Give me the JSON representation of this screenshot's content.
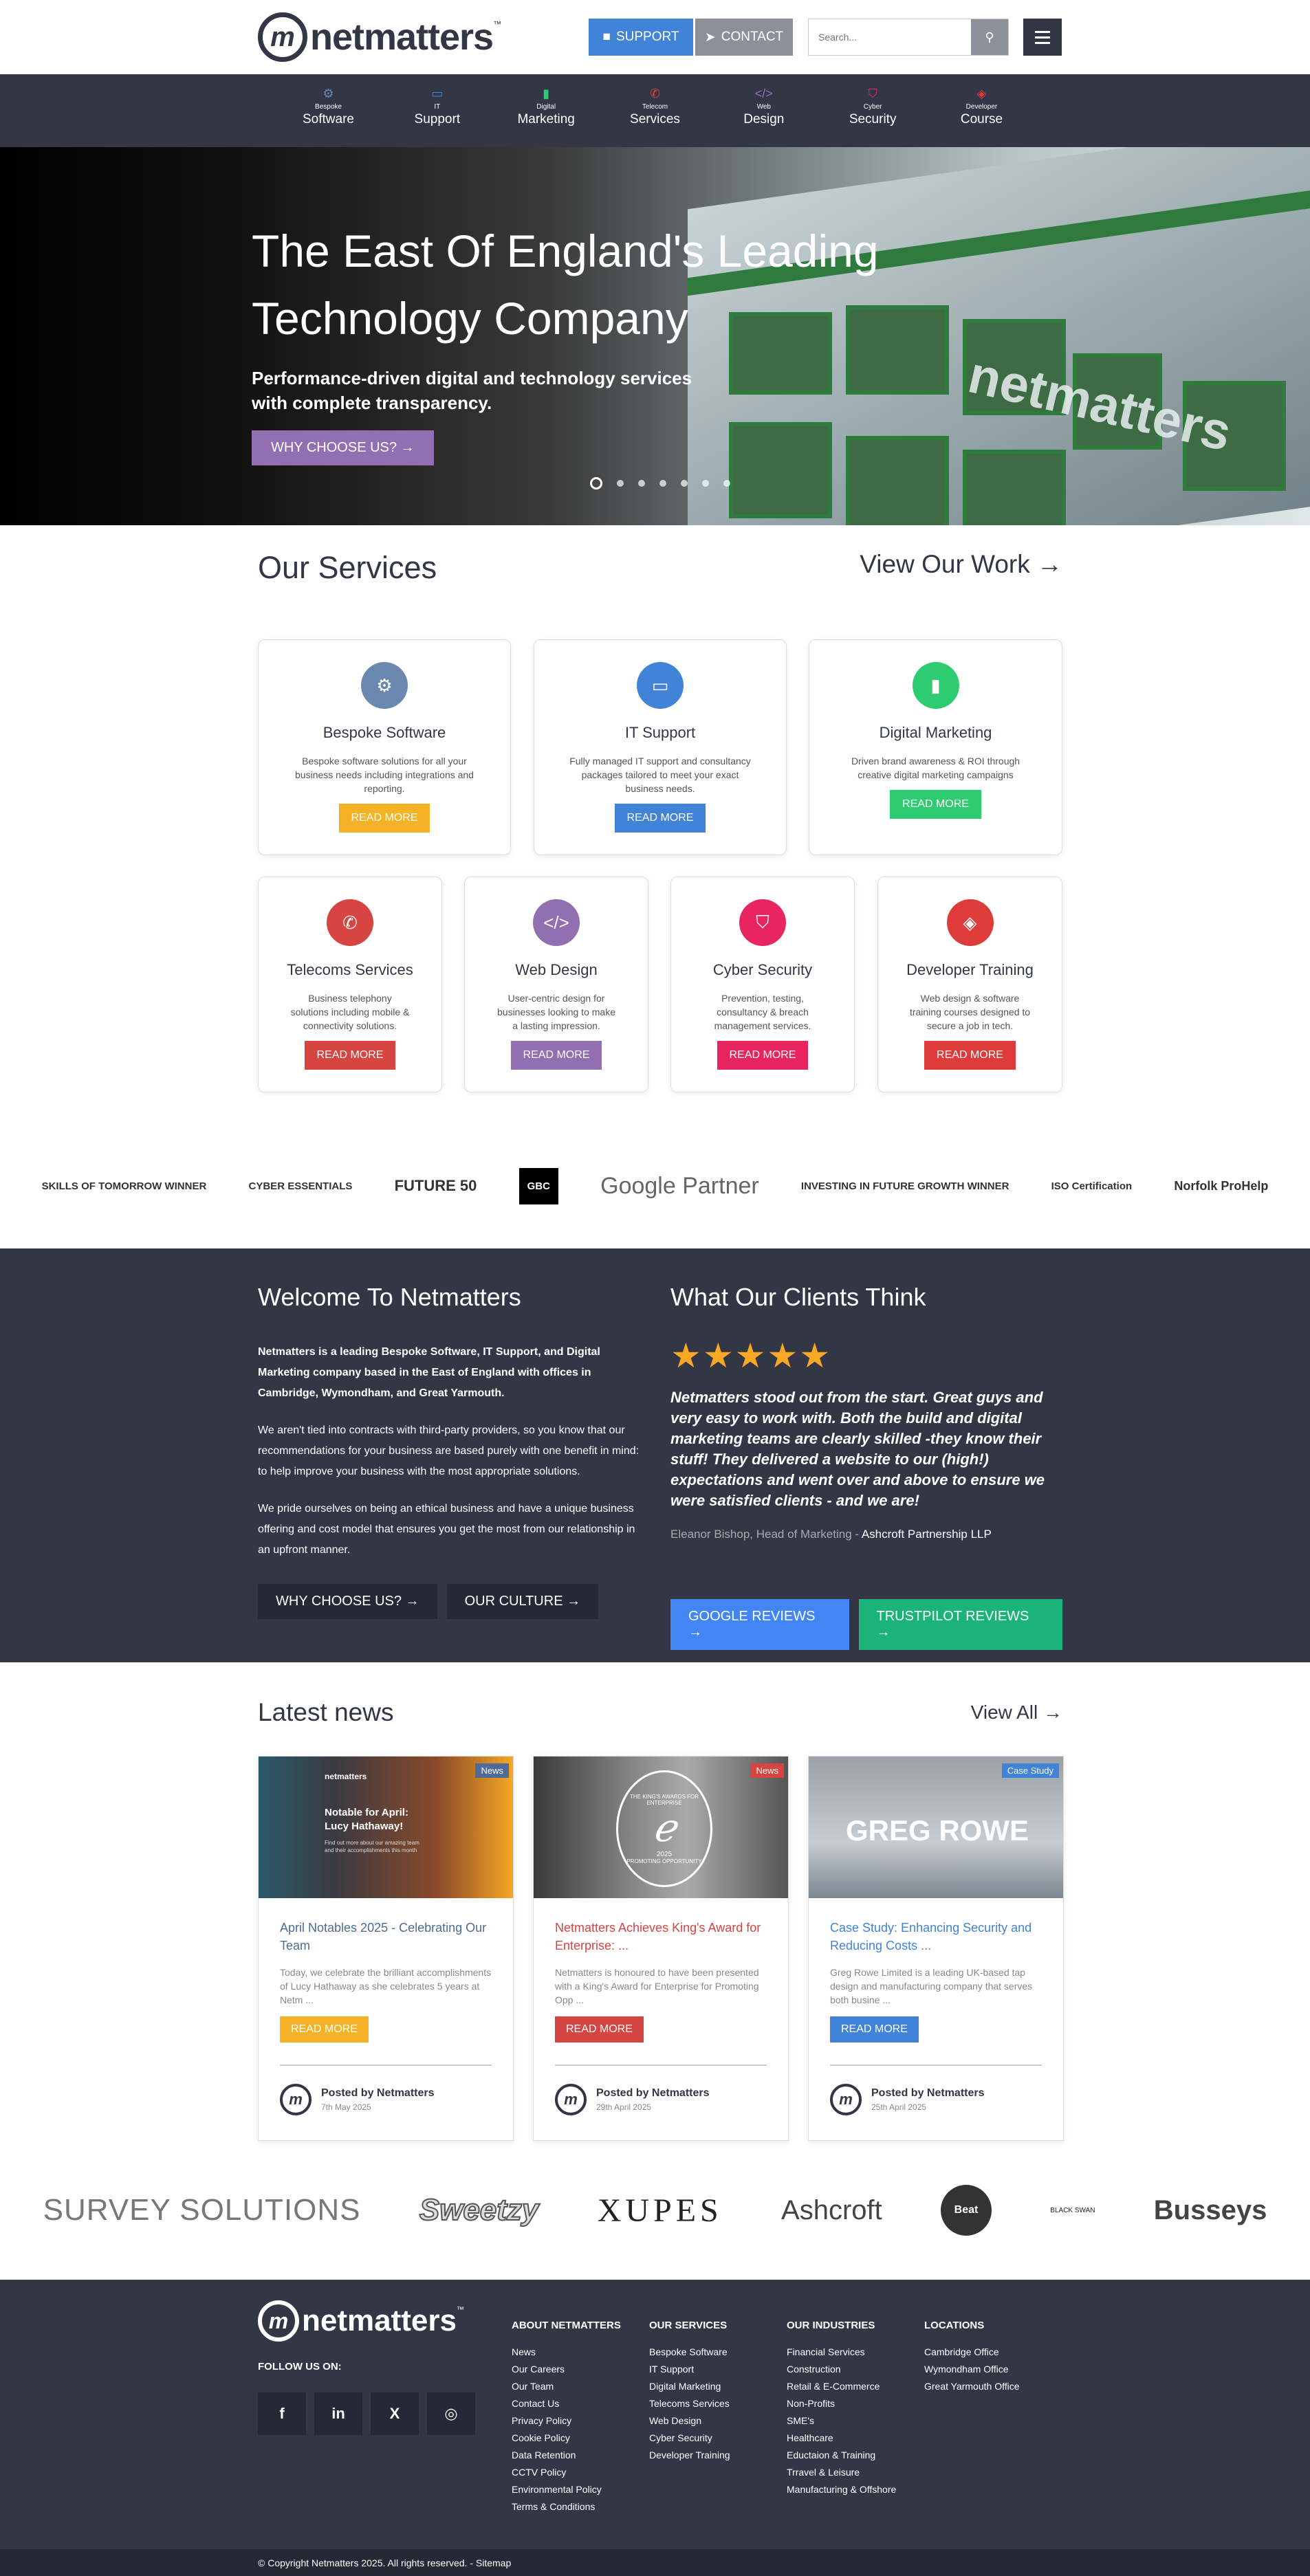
{
  "header": {
    "logo_text": "netmatters",
    "logo_mark": "m",
    "logo_tm": "™",
    "support_label": "SUPPORT",
    "contact_label": "CONTACT",
    "search_placeholder": "Search..."
  },
  "nav": [
    {
      "small": "Bespoke",
      "big": "Software",
      "icon": "gear-icon",
      "color": "#6a88b0",
      "glyph": "⚙"
    },
    {
      "small": "IT",
      "big": "Support",
      "icon": "monitor-icon",
      "color": "#4183d7",
      "glyph": "▭"
    },
    {
      "small": "Digital",
      "big": "Marketing",
      "icon": "bar-chart-icon",
      "color": "#2ecc71",
      "glyph": "▮"
    },
    {
      "small": "Telecom",
      "big": "Services",
      "icon": "phone-icon",
      "color": "#d64541",
      "glyph": "✆"
    },
    {
      "small": "Web",
      "big": "Design",
      "icon": "code-icon",
      "color": "#926fb1",
      "glyph": "</>"
    },
    {
      "small": "Cyber",
      "big": "Security",
      "icon": "shield-icon",
      "color": "#e8255f",
      "glyph": "⛉"
    },
    {
      "small": "Developer",
      "big": "Course",
      "icon": "cube-icon",
      "color": "#df3b3b",
      "glyph": "◈"
    }
  ],
  "hero": {
    "title_line1": "The East Of England's Leading",
    "title_line2": "Technology Company",
    "sub_line1": "Performance-driven digital and technology services",
    "sub_line2": "with complete transparency.",
    "cta": "WHY CHOOSE US? →",
    "building_text": "netmatters"
  },
  "services": {
    "heading": "Our Services",
    "view_work": "View Our Work →",
    "items": [
      {
        "title": "Bespoke Software",
        "desc": "Bespoke software solutions for all your business needs including integrations and reporting.",
        "button": "READ MORE",
        "color": "#6a88b0",
        "btn_color": "#f5b225",
        "icon": "gear-icon",
        "glyph": "⚙"
      },
      {
        "title": "IT Support",
        "desc": "Fully managed IT support and consultancy packages tailored to meet your exact business needs.",
        "button": "READ MORE",
        "color": "#4183d7",
        "btn_color": "#4183d7",
        "icon": "monitor-icon",
        "glyph": "▭"
      },
      {
        "title": "Digital Marketing",
        "desc": "Driven brand awareness & ROI through creative digital marketing campaigns",
        "button": "READ MORE",
        "color": "#2ecc71",
        "btn_color": "#2ecc71",
        "icon": "bar-chart-icon",
        "glyph": "▮"
      },
      {
        "title": "Telecoms Services",
        "desc": "Business telephony solutions including mobile & connectivity solutions.",
        "button": "READ MORE",
        "color": "#d64541",
        "btn_color": "#d64541",
        "icon": "phone-icon",
        "glyph": "✆"
      },
      {
        "title": "Web Design",
        "desc": "User-centric design for businesses looking to make a lasting impression.",
        "button": "READ MORE",
        "color": "#926fb1",
        "btn_color": "#926fb1",
        "icon": "code-icon",
        "glyph": "</>"
      },
      {
        "title": "Cyber Security",
        "desc": "Prevention, testing, consultancy & breach management services.",
        "button": "READ MORE",
        "color": "#e8255f",
        "btn_color": "#e8255f",
        "icon": "shield-icon",
        "glyph": "⛉"
      },
      {
        "title": "Developer Training",
        "desc": "Web design & software training courses designed to secure a job in tech.",
        "button": "READ MORE",
        "color": "#df3b3b",
        "btn_color": "#df3b3b",
        "icon": "cube-icon",
        "glyph": "◈"
      }
    ]
  },
  "accreditations": [
    "SKILLS OF TOMORROW WINNER",
    "CYBER ESSENTIALS",
    "FUTURE 50",
    "GBC",
    "Google Partner",
    "INVESTING IN FUTURE GROWTH WINNER",
    "ISO Certification",
    "Norfolk ProHelp"
  ],
  "welcome": {
    "heading": "Welcome To Netmatters",
    "p1": "Netmatters is a leading Bespoke Software, IT Support, and Digital Marketing company based in the East of England with offices in Cambridge, Wymondham, and Great Yarmouth.",
    "p2": "We aren't tied into contracts with third-party providers, so you know that our recommendations for your business are based purely with one benefit in mind: to help improve your business with the most appropriate solutions.",
    "p3": "We pride ourselves on being an ethical business and have a unique business offering and cost model that ensures you get the most from our relationship in an upfront manner.",
    "btn1": "WHY CHOOSE US? →",
    "btn2": "OUR CULTURE →"
  },
  "testimonial": {
    "heading": "What Our Clients Think",
    "stars": "★★★★★",
    "rating": 5,
    "quote": "Netmatters stood out from the start. Great guys and very easy to work with. Both the build and digital marketing teams are clearly skilled -they know their stuff! They delivered a website to our (high!) expectations and went over and above to ensure we were satisfied clients - and we are!",
    "author": "Eleanor Bishop, Head of Marketing - ",
    "company": "Ashcroft Partnership LLP",
    "google_btn": "GOOGLE REVIEWS →",
    "trustpilot_btn": "TRUSTPILOT REVIEWS →"
  },
  "news": {
    "heading": "Latest news",
    "view_all": "View All →",
    "items": [
      {
        "tag": "News",
        "tag_color": "#4f6b95",
        "title": "April Notables 2025 - Celebrating Our Team",
        "title_color": "#4f6b95",
        "excerpt": "Today, we celebrate the brilliant accomplishments of Lucy Hathaway as she celebrates 5 years at Netm ...",
        "button": "READ MORE",
        "btn_color": "#f5b225",
        "author": "Posted by Netmatters",
        "date": "7th May 2025",
        "img_title": "Notable for April: Lucy Hathaway!",
        "img_sub": "Find out more about our amazing team and their accomplishments this month",
        "img_logo": "netmatters"
      },
      {
        "tag": "News",
        "tag_color": "#d64541",
        "title": "Netmatters Achieves King's Award for Enterprise: ...",
        "title_color": "#d64541",
        "excerpt": "Netmatters is honoured to have been presented with a King's Award for Enterprise for Promoting Opp ...",
        "button": "READ MORE",
        "btn_color": "#d64541",
        "author": "Posted by Netmatters",
        "date": "29th April 2025",
        "img_title": "THE KING'S AWARDS FOR ENTERPRISE",
        "img_sub": "PROMOTING OPPORTUNITY",
        "img_logo": "2025"
      },
      {
        "tag": "Case Study",
        "tag_color": "#4183d7",
        "title": "Case Study: Enhancing Security and Reducing Costs ...",
        "title_color": "#4183d7",
        "excerpt": "Greg Rowe Limited is a leading UK-based tap design and manufacturing company that serves both busine ...",
        "button": "READ MORE",
        "btn_color": "#4183d7",
        "author": "Posted by Netmatters",
        "date": "25th April 2025",
        "img_title": "GREG ROWE",
        "img_sub": "",
        "img_logo": ""
      }
    ]
  },
  "clients": [
    "SURVEY SOLUTIONS",
    "Sweetzy",
    "XUPES",
    "Ashcroft",
    "Beat",
    "BLACK SWAN",
    "Busseys"
  ],
  "footer": {
    "logo_text": "netmatters",
    "logo_mark": "m",
    "logo_tm": "™",
    "follow": "FOLLOW US ON:",
    "socials": [
      "f",
      "in",
      "X",
      "◎"
    ],
    "col1": {
      "title": "ABOUT NETMATTERS",
      "links": [
        "News",
        "Our Careers",
        "Our Team",
        "Contact Us",
        "Privacy Policy",
        "Cookie Policy",
        "Data Retention",
        "CCTV Policy",
        "Environmental Policy",
        "Terms & Conditions"
      ]
    },
    "col2": {
      "title": "OUR SERVICES",
      "links": [
        "Bespoke Software",
        "IT Support",
        "Digital Marketing",
        "Telecoms Services",
        "Web Design",
        "Cyber Security",
        "Developer Training"
      ]
    },
    "col3": {
      "title": "OUR INDUSTRIES",
      "links": [
        "Financial Services",
        "Construction",
        "Retail & E-Commerce",
        "Non-Profits",
        "SME's",
        "Healthcare",
        "Eductaion & Training",
        "Trravel & Leisure",
        "Manufacturing & Offshore"
      ]
    },
    "col4": {
      "title": "LOCATIONS",
      "links": [
        "Cambridge Office",
        "Wymondham Office",
        "Great Yarmouth Office"
      ]
    },
    "copyright": "© Copyright Netmatters 2025. All rights reserved. - Sitemap"
  }
}
